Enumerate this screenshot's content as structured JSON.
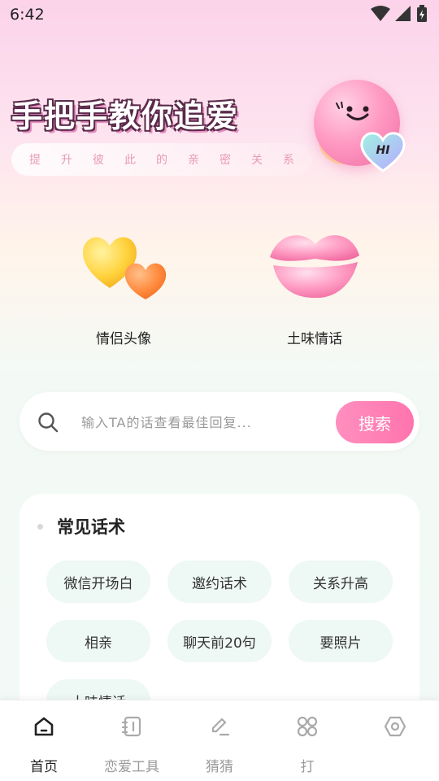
{
  "status_bar": {
    "time": "6:42"
  },
  "banner": {
    "title": "手把手教你追爱",
    "subtitle": "提升彼此的亲密关系",
    "mascot_badge": "HI"
  },
  "features": [
    {
      "label": "情侣头像",
      "icon": "hearts-icon"
    },
    {
      "label": "土味情话",
      "icon": "lips-icon"
    }
  ],
  "search": {
    "placeholder": "输入TA的话查看最佳回复...",
    "button_label": "搜索"
  },
  "phrases_section": {
    "title": "常见话术",
    "chips": [
      "微信开场白",
      "邀约话术",
      "关系升高",
      "相亲",
      "聊天前20句",
      "要照片",
      "土味情话"
    ]
  },
  "bottom_nav": {
    "items": [
      {
        "label": "首页",
        "icon": "home-icon",
        "active": true
      },
      {
        "label": "恋爱工具",
        "icon": "notebook-icon",
        "active": false
      },
      {
        "label": "猜猜",
        "icon": "edit-icon",
        "active": false
      },
      {
        "label": "打",
        "icon": "grid-icon",
        "active": false
      },
      {
        "label": "",
        "icon": "settings-icon",
        "active": false
      }
    ]
  },
  "colors": {
    "accent_pink": "#ff7fb5",
    "chip_bg": "#eef8f5",
    "subtitle_pink": "#e89ab7"
  }
}
